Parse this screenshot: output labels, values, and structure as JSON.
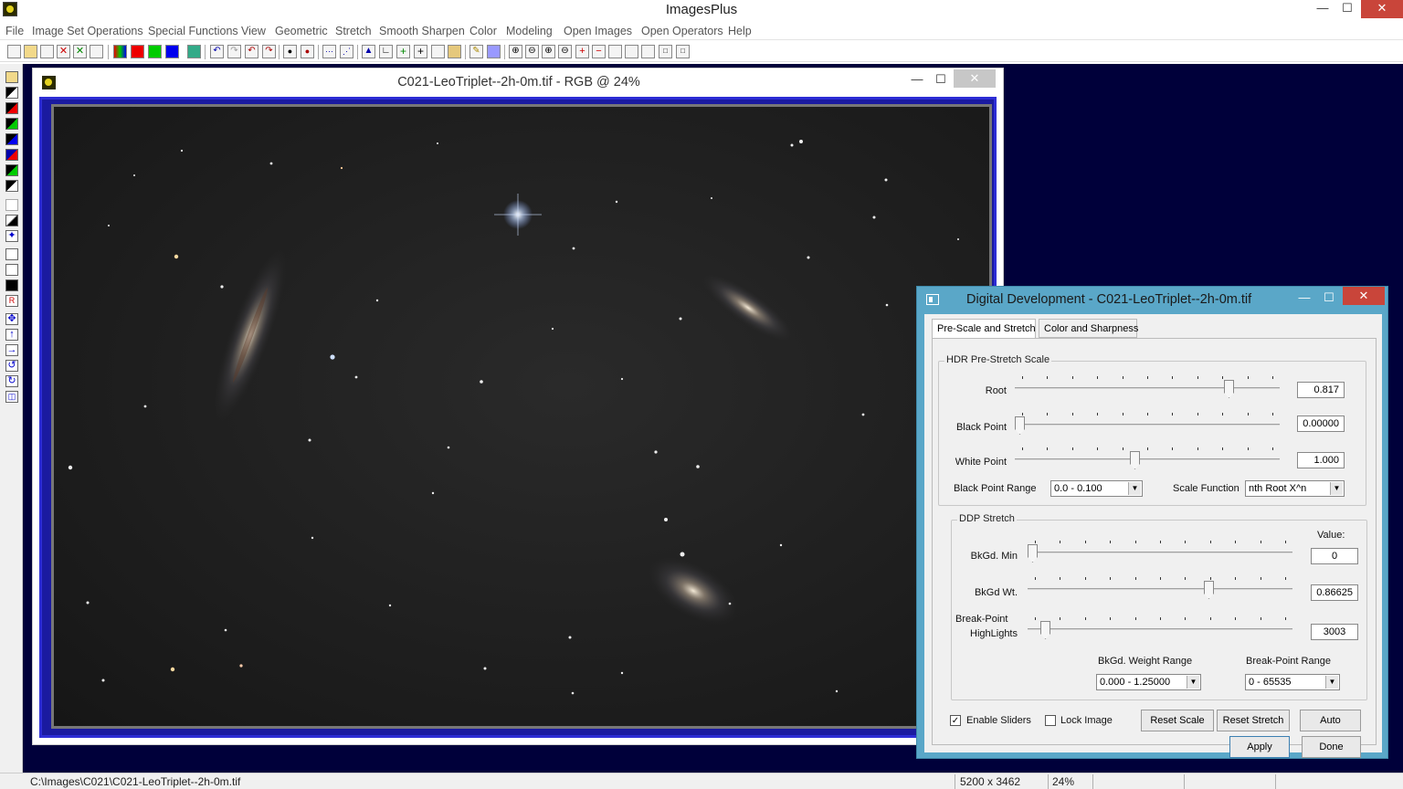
{
  "app": {
    "title": "ImagesPlus"
  },
  "menu": [
    "File",
    "Image Set Operations",
    "Special Functions",
    "View",
    "Geometric",
    "Stretch",
    "Smooth Sharpen",
    "Color",
    "Modeling",
    "Open Images",
    "Open Operators",
    "Help"
  ],
  "image_window": {
    "title": "C021-LeoTriplet--2h-0m.tif - RGB @ 24%"
  },
  "dialog": {
    "title": "Digital Development - C021-LeoTriplet--2h-0m.tif",
    "tabs": [
      "Pre-Scale and Stretch",
      "Color and Sharpness"
    ],
    "hdr": {
      "group_label": "HDR Pre-Stretch Scale",
      "root": {
        "label": "Root",
        "value": "0.817",
        "level": 0.82
      },
      "black_point": {
        "label": "Black Point",
        "value": "0.00000",
        "level": 0.0
      },
      "white_point": {
        "label": "White Point",
        "value": "1.000",
        "level": 0.45
      },
      "black_point_range": {
        "label": "Black Point Range",
        "value": "0.0 - 0.100"
      },
      "scale_function": {
        "label": "Scale Function",
        "value": "nth Root X^n"
      }
    },
    "ddp": {
      "group_label": "DDP Stretch",
      "value_header": "Value:",
      "bkgd_min": {
        "label": "BkGd. Min",
        "value": "0",
        "level": 0.0
      },
      "bkgd_wt": {
        "label": "BkGd Wt.",
        "value": "0.86625",
        "level": 0.69
      },
      "break_point": {
        "label1": "Break-Point",
        "label2": "HighLights",
        "value": "3003",
        "level": 0.05
      },
      "weight_range": {
        "label": "BkGd. Weight Range",
        "value": "0.000 - 1.25000"
      },
      "bp_range": {
        "label": "Break-Point Range",
        "value": "0 - 65535"
      }
    },
    "enable_sliders": {
      "label": "Enable Sliders",
      "checked": true
    },
    "lock_image": {
      "label": "Lock Image",
      "checked": false
    },
    "buttons": {
      "reset_scale": "Reset Scale",
      "reset_stretch": "Reset Stretch",
      "auto": "Auto",
      "apply": "Apply",
      "done": "Done"
    }
  },
  "status": {
    "path": "C:\\Images\\C021\\C021-LeoTriplet--2h-0m.tif",
    "dimensions": "5200 x 3462",
    "zoom": "24%"
  }
}
